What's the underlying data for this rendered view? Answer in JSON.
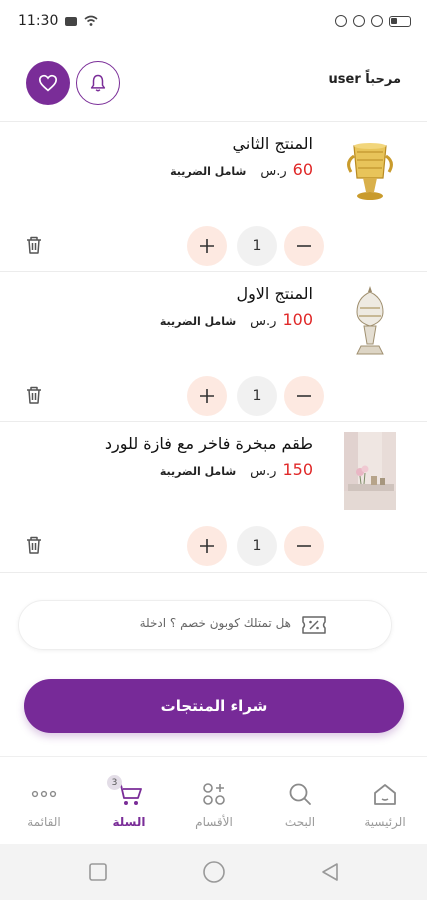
{
  "status_bar": {
    "time": "11:30"
  },
  "header": {
    "greeting": "مرحباً user"
  },
  "colors": {
    "accent": "#7a2d98",
    "price": "#e02828",
    "stepper_bg": "#fde9e1"
  },
  "cart": {
    "tax_label": "شامل الضريبة",
    "currency": "ر.س",
    "items": [
      {
        "title": "المنتج الثاني",
        "price": "60",
        "quantity": "1",
        "image": "gold-censer-image"
      },
      {
        "title": "المنتج الاول",
        "price": "100",
        "quantity": "1",
        "image": "silver-censer-image"
      },
      {
        "title": "طقم مبخرة فاخر مع فازة للورد",
        "price": "150",
        "quantity": "1",
        "image": "censer-set-photo"
      }
    ]
  },
  "coupon": {
    "placeholder": "هل تمتلك كوبون خصم ؟ ادخلة",
    "icon": "coupon-ticket-icon"
  },
  "buy_button": {
    "label": "شراء المنتجات"
  },
  "bottom_nav": {
    "items": [
      {
        "label": "الرئيسية",
        "icon": "home-icon"
      },
      {
        "label": "البحث",
        "icon": "search-icon"
      },
      {
        "label": "الأقسام",
        "icon": "categories-icon"
      },
      {
        "label": "السلة",
        "icon": "cart-icon",
        "active": true,
        "badge": "3"
      },
      {
        "label": "القائمة",
        "icon": "more-icon"
      }
    ]
  }
}
